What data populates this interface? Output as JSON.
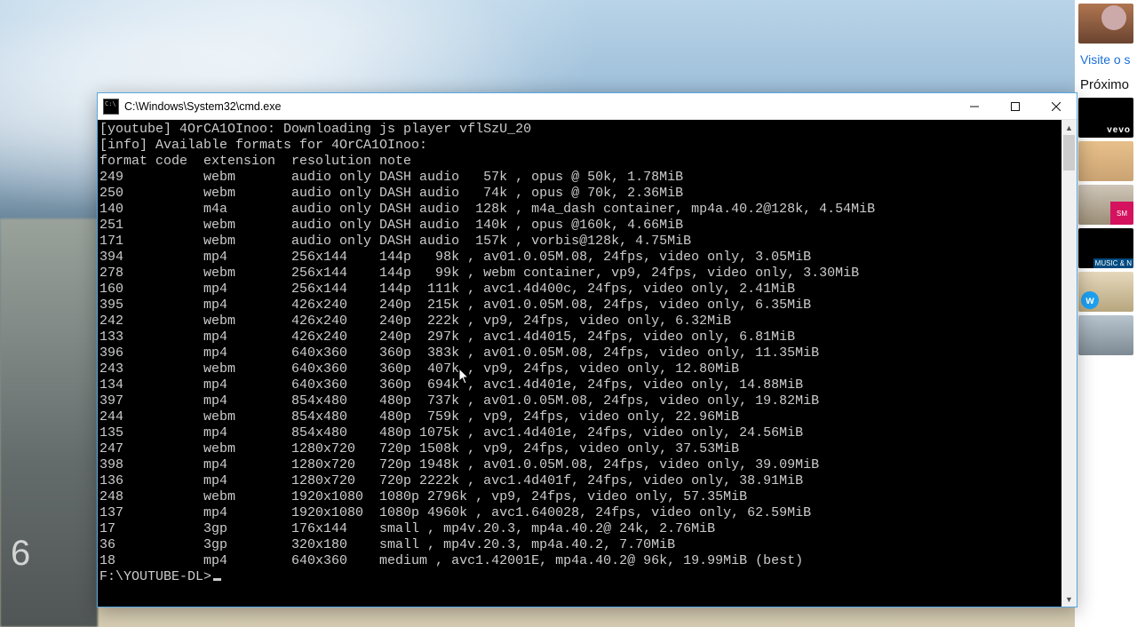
{
  "window": {
    "title": "C:\\Windows\\System32\\cmd.exe"
  },
  "right": {
    "visit": "Visite o s",
    "next": "Próximo",
    "vevo": "vevo",
    "music_n": "MUSIC & N"
  },
  "bg_num": "6",
  "term": {
    "header1": "[youtube] 4OrCA1OInoo: Downloading js player vflSzU_20",
    "header2": "[info] Available formats for 4OrCA1OInoo:",
    "header3": "format code  extension  resolution note",
    "rows": [
      "249          webm       audio only DASH audio   57k , opus @ 50k, 1.78MiB",
      "250          webm       audio only DASH audio   74k , opus @ 70k, 2.36MiB",
      "140          m4a        audio only DASH audio  128k , m4a_dash container, mp4a.40.2@128k, 4.54MiB",
      "251          webm       audio only DASH audio  140k , opus @160k, 4.66MiB",
      "171          webm       audio only DASH audio  157k , vorbis@128k, 4.75MiB",
      "394          mp4        256x144    144p   98k , av01.0.05M.08, 24fps, video only, 3.05MiB",
      "278          webm       256x144    144p   99k , webm container, vp9, 24fps, video only, 3.30MiB",
      "160          mp4        256x144    144p  111k , avc1.4d400c, 24fps, video only, 2.41MiB",
      "395          mp4        426x240    240p  215k , av01.0.05M.08, 24fps, video only, 6.35MiB",
      "242          webm       426x240    240p  222k , vp9, 24fps, video only, 6.32MiB",
      "133          mp4        426x240    240p  297k , avc1.4d4015, 24fps, video only, 6.81MiB",
      "396          mp4        640x360    360p  383k , av01.0.05M.08, 24fps, video only, 11.35MiB",
      "243          webm       640x360    360p  407k , vp9, 24fps, video only, 12.80MiB",
      "134          mp4        640x360    360p  694k , avc1.4d401e, 24fps, video only, 14.88MiB",
      "397          mp4        854x480    480p  737k , av01.0.05M.08, 24fps, video only, 19.82MiB",
      "244          webm       854x480    480p  759k , vp9, 24fps, video only, 22.96MiB",
      "135          mp4        854x480    480p 1075k , avc1.4d401e, 24fps, video only, 24.56MiB",
      "247          webm       1280x720   720p 1508k , vp9, 24fps, video only, 37.53MiB",
      "398          mp4        1280x720   720p 1948k , av01.0.05M.08, 24fps, video only, 39.09MiB",
      "136          mp4        1280x720   720p 2222k , avc1.4d401f, 24fps, video only, 38.91MiB",
      "248          webm       1920x1080  1080p 2796k , vp9, 24fps, video only, 57.35MiB",
      "137          mp4        1920x1080  1080p 4960k , avc1.640028, 24fps, video only, 62.59MiB",
      "17           3gp        176x144    small , mp4v.20.3, mp4a.40.2@ 24k, 2.76MiB",
      "36           3gp        320x180    small , mp4v.20.3, mp4a.40.2, 7.70MiB",
      "18           mp4        640x360    medium , avc1.42001E, mp4a.40.2@ 96k, 19.99MiB (best)"
    ],
    "blank": "",
    "prompt": "F:\\YOUTUBE-DL>"
  }
}
